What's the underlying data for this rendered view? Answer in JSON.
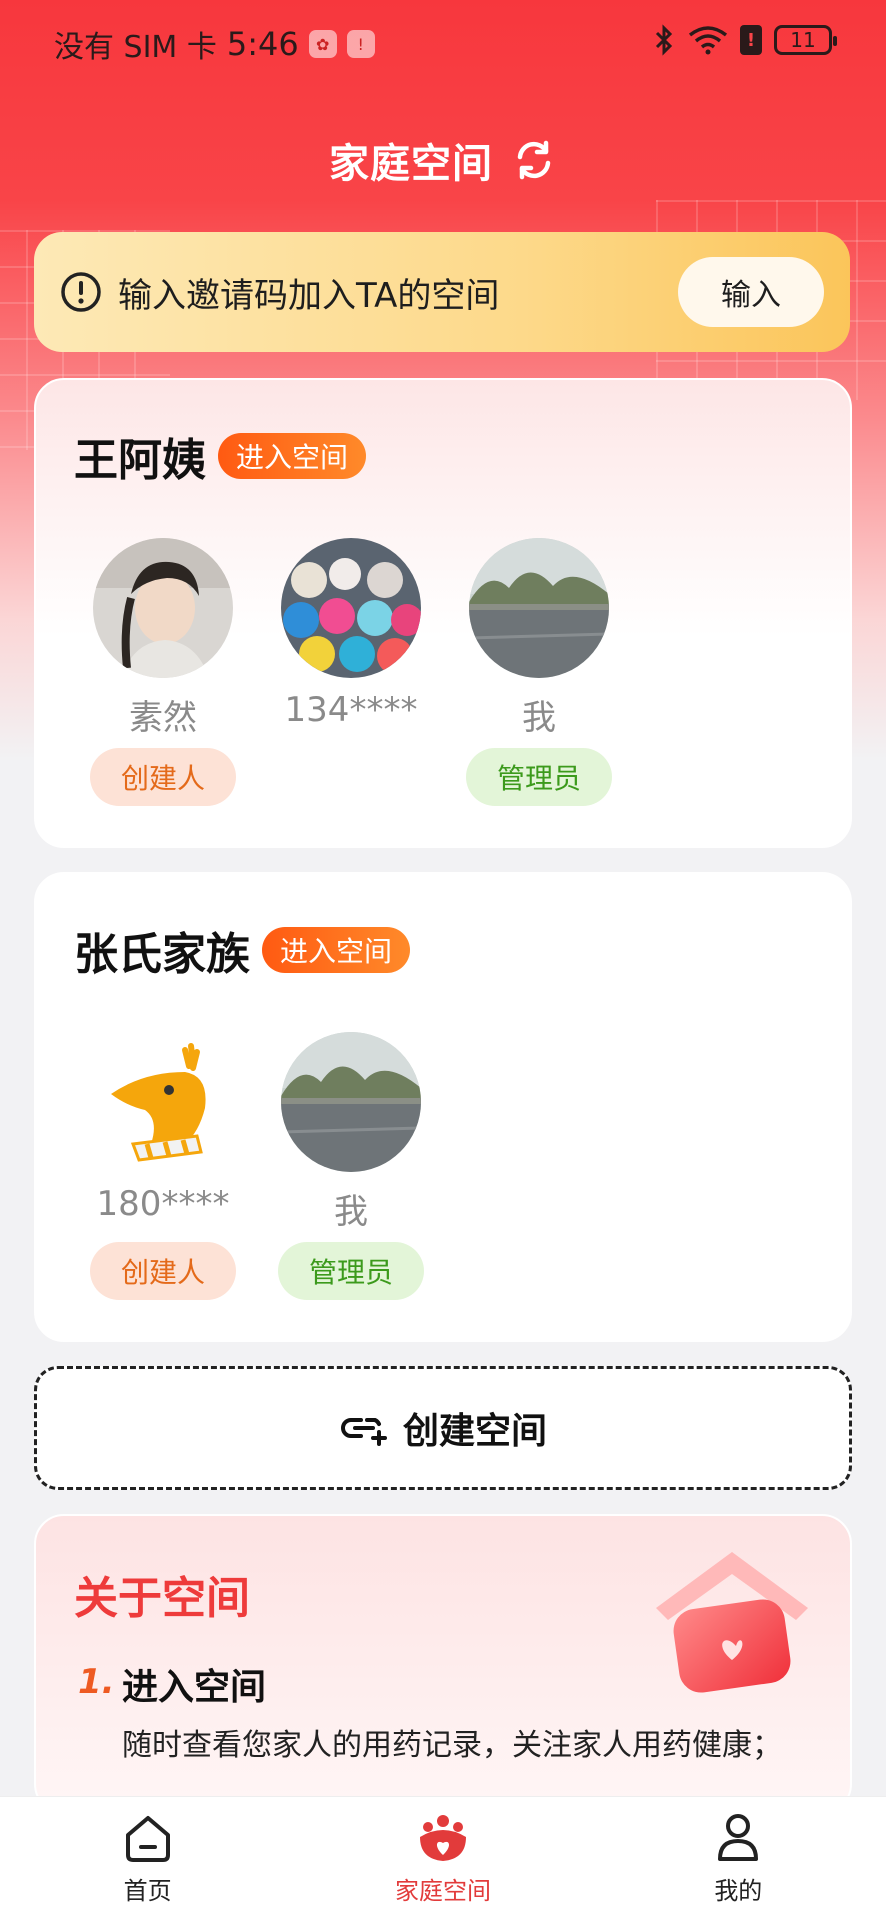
{
  "status": {
    "carrier": "没有 SIM 卡",
    "time": "5:46",
    "battery": "11"
  },
  "header": {
    "title": "家庭空间",
    "refresh_icon": "refresh-icon"
  },
  "invite": {
    "text": "输入邀请码加入TA的空间",
    "button": "输入"
  },
  "spaces": [
    {
      "name": "王阿姨",
      "enter": "进入空间",
      "members": [
        {
          "name": "素然",
          "role": "创建人"
        },
        {
          "name": "134****",
          "role": ""
        },
        {
          "name": "我",
          "role": "管理员"
        }
      ]
    },
    {
      "name": "张氏家族",
      "enter": "进入空间",
      "members": [
        {
          "name": "180****",
          "role": "创建人"
        },
        {
          "name": "我",
          "role": "管理员"
        }
      ]
    }
  ],
  "create": {
    "label": "创建空间"
  },
  "about": {
    "title": "关于空间",
    "steps": [
      {
        "num": "1.",
        "title": "进入空间",
        "desc": "随时查看您家人的用药记录，关注家人用药健康；"
      }
    ]
  },
  "tabbar": [
    {
      "label": "首页"
    },
    {
      "label": "家庭空间"
    },
    {
      "label": "我的"
    }
  ],
  "colors": {
    "brand_red": "#f94448",
    "creator": "#e46a1a",
    "admin": "#3c9a1c",
    "enter": "#ff6a1a"
  }
}
